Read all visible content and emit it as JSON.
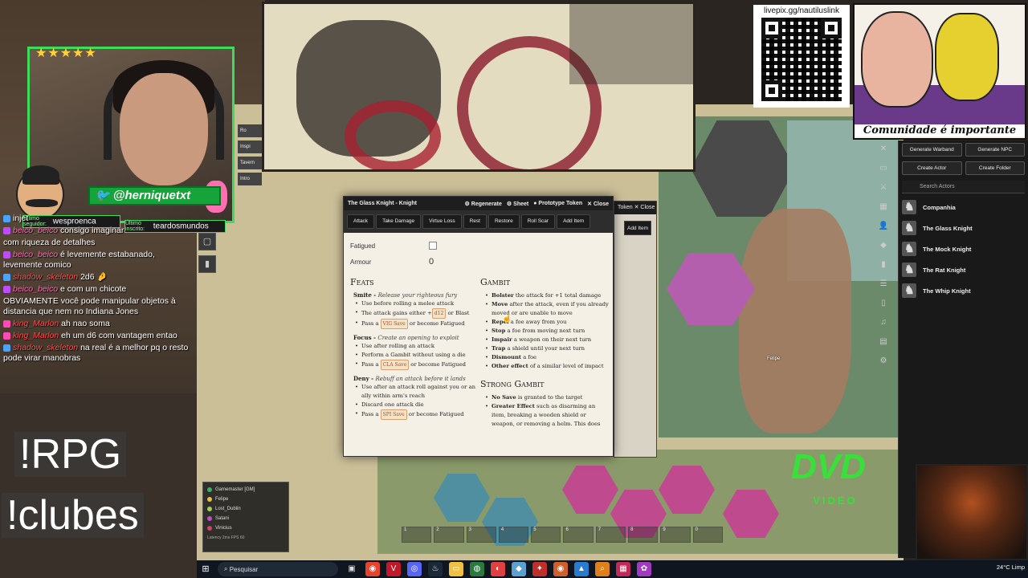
{
  "stream": {
    "qr_label": "livepix.gg/nautiluslink",
    "meme_caption": "Comunidade é importante",
    "stars": "★★★★★",
    "twitter_handle": "@herniquetxt",
    "last_follower_label": "Último seguidor:",
    "last_follower": "wesproenca",
    "last_subscriber_label": "Último inscrito:",
    "last_subscriber": "teardosmundos",
    "cmd_rpg": "!RPG",
    "cmd_clubes": "!clubes",
    "dvd": "DVD",
    "dvd_sub": "VIDEO"
  },
  "chat": [
    {
      "user": "",
      "text": "injet",
      "badge": "#4aa3ff",
      "red": false
    },
    {
      "user": "beico_beico",
      "text": "consigo imaginar",
      "badge": "#c04aff",
      "red": false
    },
    {
      "user": "",
      "text": "com riqueza de detalhes",
      "badge": "",
      "red": false
    },
    {
      "user": "beico_beico",
      "text": "é levemente estabanado, levemente comico",
      "badge": "#c04aff",
      "red": false
    },
    {
      "user": "shadow_skeleton",
      "text": "2d6 🤌",
      "badge": "#4aa3ff",
      "red": true
    },
    {
      "user": "beico_beico",
      "text": "e com um chicote",
      "badge": "#c04aff",
      "red": false
    },
    {
      "user": "",
      "text": "OBVIAMENTE você pode manipular objetos à distancia que nem no Indiana Jones",
      "badge": "",
      "red": false
    },
    {
      "user": "king_Marlon",
      "text": "ah nao soma",
      "badge": "#ff4ab4",
      "red": true
    },
    {
      "user": "king_Marlon",
      "text": "eh um d6 com vantagem entao",
      "badge": "#ff4ab4",
      "red": true
    },
    {
      "user": "shadow_skeleton",
      "text": "na real é a melhor pq o resto pode virar manobras",
      "badge": "#4aa3ff",
      "red": true
    }
  ],
  "foundry": {
    "scenes": [
      "Ro",
      "Inspi",
      "Tavern",
      "Intro"
    ],
    "players": [
      {
        "name": "Gamemaster [GM]",
        "color": "#3fae6a"
      },
      {
        "name": "Felipe",
        "color": "#e0c050"
      },
      {
        "name": "Lost_Dublin",
        "color": "#a0d060"
      },
      {
        "name": "Satani",
        "color": "#c050c0"
      },
      {
        "name": "Vinicius",
        "color": "#d04070"
      }
    ],
    "latency": "Latency 2ms  FPS 60",
    "token_label": "Felipe",
    "hotbar": [
      "1",
      "2",
      "3",
      "4",
      "5",
      "6",
      "7",
      "8",
      "9",
      "0"
    ]
  },
  "sheet": {
    "title": "The Glass Knight - Knight",
    "header_buttons": [
      "Regenerate",
      "Sheet",
      "Prototype Token",
      "Close"
    ],
    "toolbar": [
      "Attack",
      "Take Damage",
      "Virtue Loss",
      "Rest",
      "Restore",
      "Roll Scar",
      "Add Item"
    ],
    "fatigued_label": "Fatigued",
    "armour_label": "Armour",
    "armour_value": "0",
    "feats_title": "Feats",
    "smite": {
      "name": "Smite",
      "desc": "Release your righteous fury",
      "b1": "Use before rolling a melee attack",
      "b2a": "The attack gains either +",
      "b2_tag": "d12",
      "b2b": " or Blast",
      "b3a": "Pass a ",
      "b3_tag": "VIG Save",
      "b3b": " or become Fatigued"
    },
    "focus": {
      "name": "Focus",
      "desc": "Create an opening to exploit",
      "b1": "Use after rolling an attack",
      "b2": "Perform a Gambit without using a die",
      "b3a": "Pass a ",
      "b3_tag": "CLA Save",
      "b3b": " or become Fatigued"
    },
    "deny": {
      "name": "Deny",
      "desc": "Rebuff an attack before it lands",
      "b1": "Use after an attack roll against you or an ally within arm's reach",
      "b2": "Discard one attack die",
      "b3a": "Pass a ",
      "b3_tag": "SPI Save",
      "b3b": " or become Fatigued"
    },
    "gambit_title": "Gambit",
    "gambit": [
      {
        "k": "Bolster",
        "v": " the attack for +1 total damage"
      },
      {
        "k": "Move",
        "v": " after the attack, even if you already moved or are unable to move"
      },
      {
        "k": "Repel",
        "v": " a foe away from you"
      },
      {
        "k": "Stop",
        "v": " a foe from moving next turn"
      },
      {
        "k": "Impair",
        "v": " a weapon on their next turn"
      },
      {
        "k": "Trap",
        "v": " a shield until your next turn"
      },
      {
        "k": "Dismount",
        "v": " a foe"
      },
      {
        "k": "Other effect",
        "v": " of a similar level of impact"
      }
    ],
    "strong_title": "Strong Gambit",
    "strong": [
      {
        "k": "No Save",
        "v": " is granted to the target"
      },
      {
        "k": "Greater Effect",
        "v": " such as disarming an item, breaking a wooden shield or weapon, or removing a helm. This does"
      }
    ]
  },
  "sheet2": {
    "header": "Token ✕ Close",
    "btn": "Add Item"
  },
  "actors": {
    "buttons": [
      "Generate Warband",
      "Generate NPC",
      "Create Actor",
      "Create Folder"
    ],
    "search_placeholder": "Search Actors",
    "list": [
      "Companhia",
      "The Glass Knight",
      "The Mock Knight",
      "The Rat Knight",
      "The Whip Knight"
    ]
  },
  "taskbar": {
    "search": "Pesquisar",
    "weather": "24°C  Limp"
  }
}
